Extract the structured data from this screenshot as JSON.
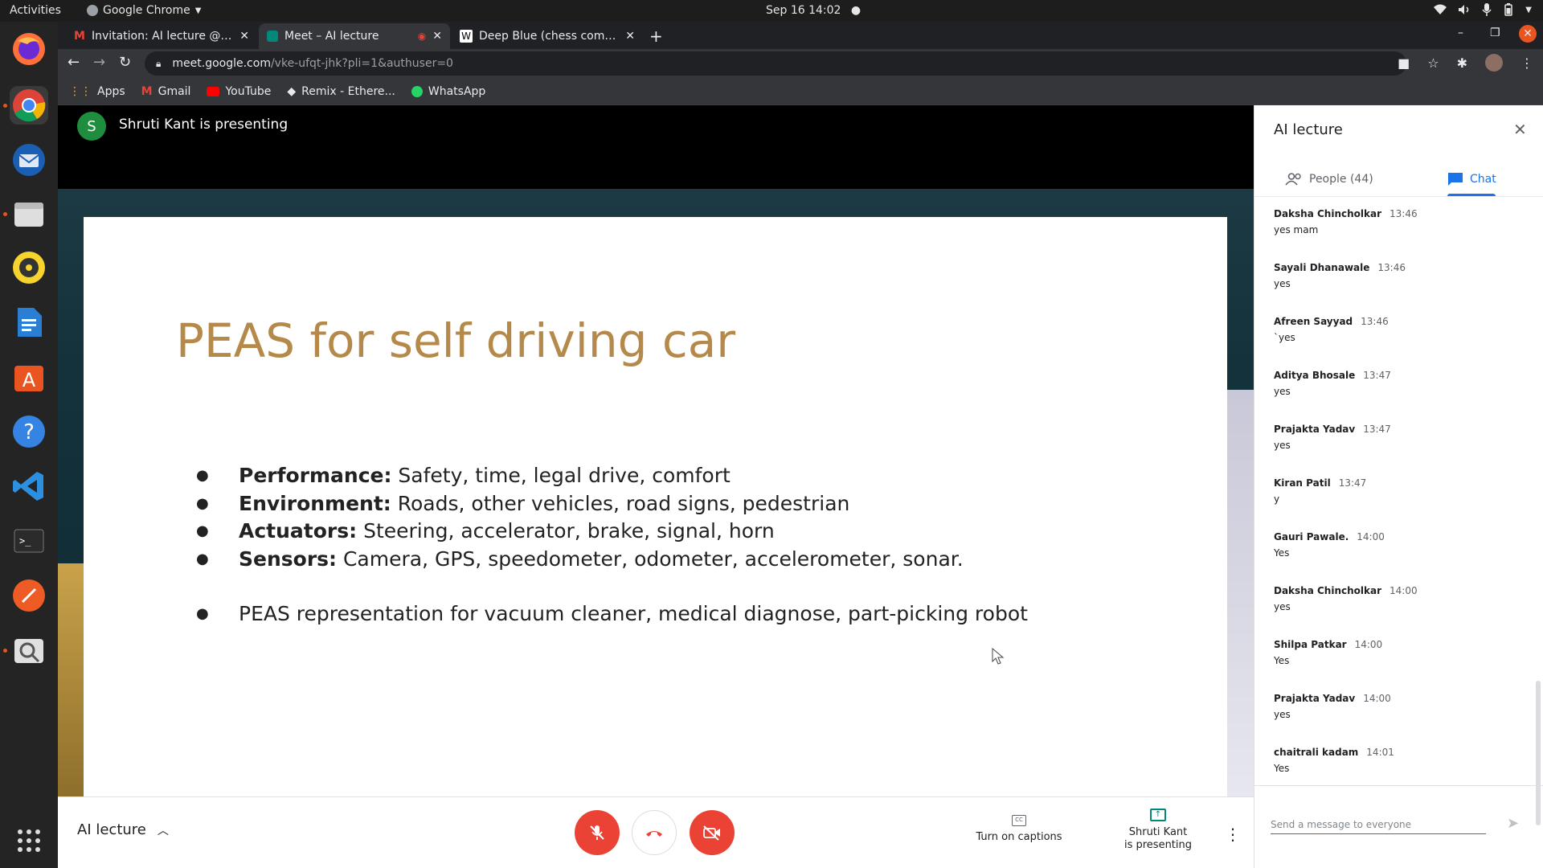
{
  "system": {
    "activities": "Activities",
    "app_name": "Google Chrome",
    "clock": "Sep 16  14:02"
  },
  "tabs": [
    {
      "title": "Invitation: AI lecture @ W",
      "icon": "gmail-icon"
    },
    {
      "title": "Meet – AI lecture",
      "icon": "meet-icon"
    },
    {
      "title": "Deep Blue (chess computer)",
      "icon": "wikipedia-icon"
    }
  ],
  "address": {
    "host": "meet.google.com",
    "path": "/vke-ufqt-jhk?pli=1&authuser=0"
  },
  "bookmarks": [
    {
      "label": "Apps"
    },
    {
      "label": "Gmail"
    },
    {
      "label": "YouTube"
    },
    {
      "label": "Remix - Ethere..."
    },
    {
      "label": "WhatsApp"
    }
  ],
  "presenter": {
    "initial": "S",
    "text": "Shruti Kant is presenting"
  },
  "slide": {
    "title": "PEAS for self driving car",
    "items": [
      {
        "bold": "Performance:",
        "text": " Safety, time, legal drive, comfort"
      },
      {
        "bold": "Environment:",
        "text": " Roads, other vehicles, road signs, pedestrian"
      },
      {
        "bold": "Actuators:",
        "text": " Steering, accelerator, brake, signal, horn"
      },
      {
        "bold": "Sensors:",
        "text": " Camera, GPS, speedometer, odometer, accelerometer, sonar."
      },
      {
        "bold": "",
        "text": "PEAS representation for vacuum cleaner, medical diagnose, part-picking robot"
      }
    ]
  },
  "bottom_bar": {
    "meeting_name": "AI lecture",
    "captions_label": "Turn on captions",
    "presenting_line1": "Shruti Kant",
    "presenting_line2": "is presenting"
  },
  "panel": {
    "title": "AI lecture",
    "people_tab": "People (44)",
    "chat_tab": "Chat",
    "input_placeholder": "Send a message to everyone",
    "messages": [
      {
        "sender": "Daksha Chincholkar",
        "time": "13:46",
        "text": "yes mam"
      },
      {
        "sender": "Sayali Dhanawale",
        "time": "13:46",
        "text": "yes"
      },
      {
        "sender": "Afreen Sayyad",
        "time": "13:46",
        "text": "`yes"
      },
      {
        "sender": "Aditya Bhosale",
        "time": "13:47",
        "text": "yes"
      },
      {
        "sender": "Prajakta Yadav",
        "time": "13:47",
        "text": "yes"
      },
      {
        "sender": "Kiran Patil",
        "time": "13:47",
        "text": "y"
      },
      {
        "sender": "Gauri Pawale.",
        "time": "14:00",
        "text": "Yes"
      },
      {
        "sender": "Daksha Chincholkar",
        "time": "14:00",
        "text": "yes"
      },
      {
        "sender": "Shilpa Patkar",
        "time": "14:00",
        "text": "Yes"
      },
      {
        "sender": "Prajakta Yadav",
        "time": "14:00",
        "text": "yes"
      },
      {
        "sender": "chaitrali kadam",
        "time": "14:01",
        "text": "Yes"
      }
    ]
  },
  "colors": {
    "accent_blue": "#1a73e8",
    "meet_red": "#ea4335",
    "slide_title": "#b5894a",
    "presenter_avatar": "#1e8e3e"
  }
}
